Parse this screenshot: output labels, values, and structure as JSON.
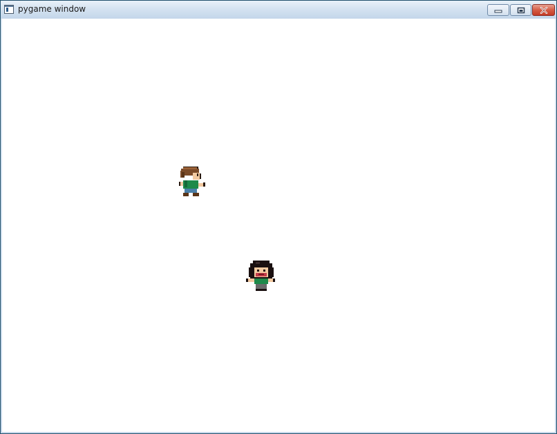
{
  "window": {
    "title": "pygame window",
    "icons": {
      "app": "pygame-window-icon",
      "minimize": "minimize-icon",
      "maximize": "maximize-icon",
      "close": "close-icon"
    }
  },
  "game": {
    "background_color": "#ffffff",
    "characters": [
      {
        "name": "brown-haired-boy",
        "shirt_color": "#1e8a4a",
        "hair_color": "#7a4a28",
        "pants_color": "#4a7fa8"
      },
      {
        "name": "dark-haired-girl",
        "shirt_color": "#1e8a4a",
        "hair_color": "#1a1010"
      }
    ]
  }
}
